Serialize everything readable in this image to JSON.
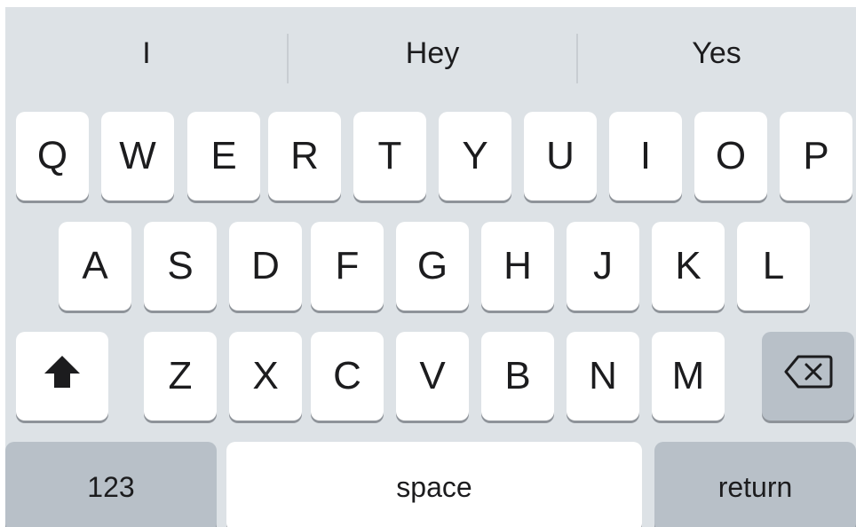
{
  "suggestions": {
    "items": [
      "I",
      "Hey",
      "Yes"
    ]
  },
  "keyboard": {
    "row1": [
      "Q",
      "W",
      "E",
      "R",
      "T",
      "Y",
      "U",
      "I",
      "O",
      "P"
    ],
    "row2": [
      "A",
      "S",
      "D",
      "F",
      "G",
      "H",
      "J",
      "K",
      "L"
    ],
    "row3": [
      "Z",
      "X",
      "C",
      "V",
      "B",
      "N",
      "M"
    ],
    "numbers_label": "123",
    "space_label": "space",
    "return_label": "return",
    "shift_icon": "shift-arrow-up-icon",
    "delete_icon": "backspace-delete-icon"
  },
  "colors": {
    "keyboard_background": "#dde2e6",
    "key_background": "#ffffff",
    "function_key_background": "#b8c0c8",
    "text": "#1c1c1e"
  }
}
